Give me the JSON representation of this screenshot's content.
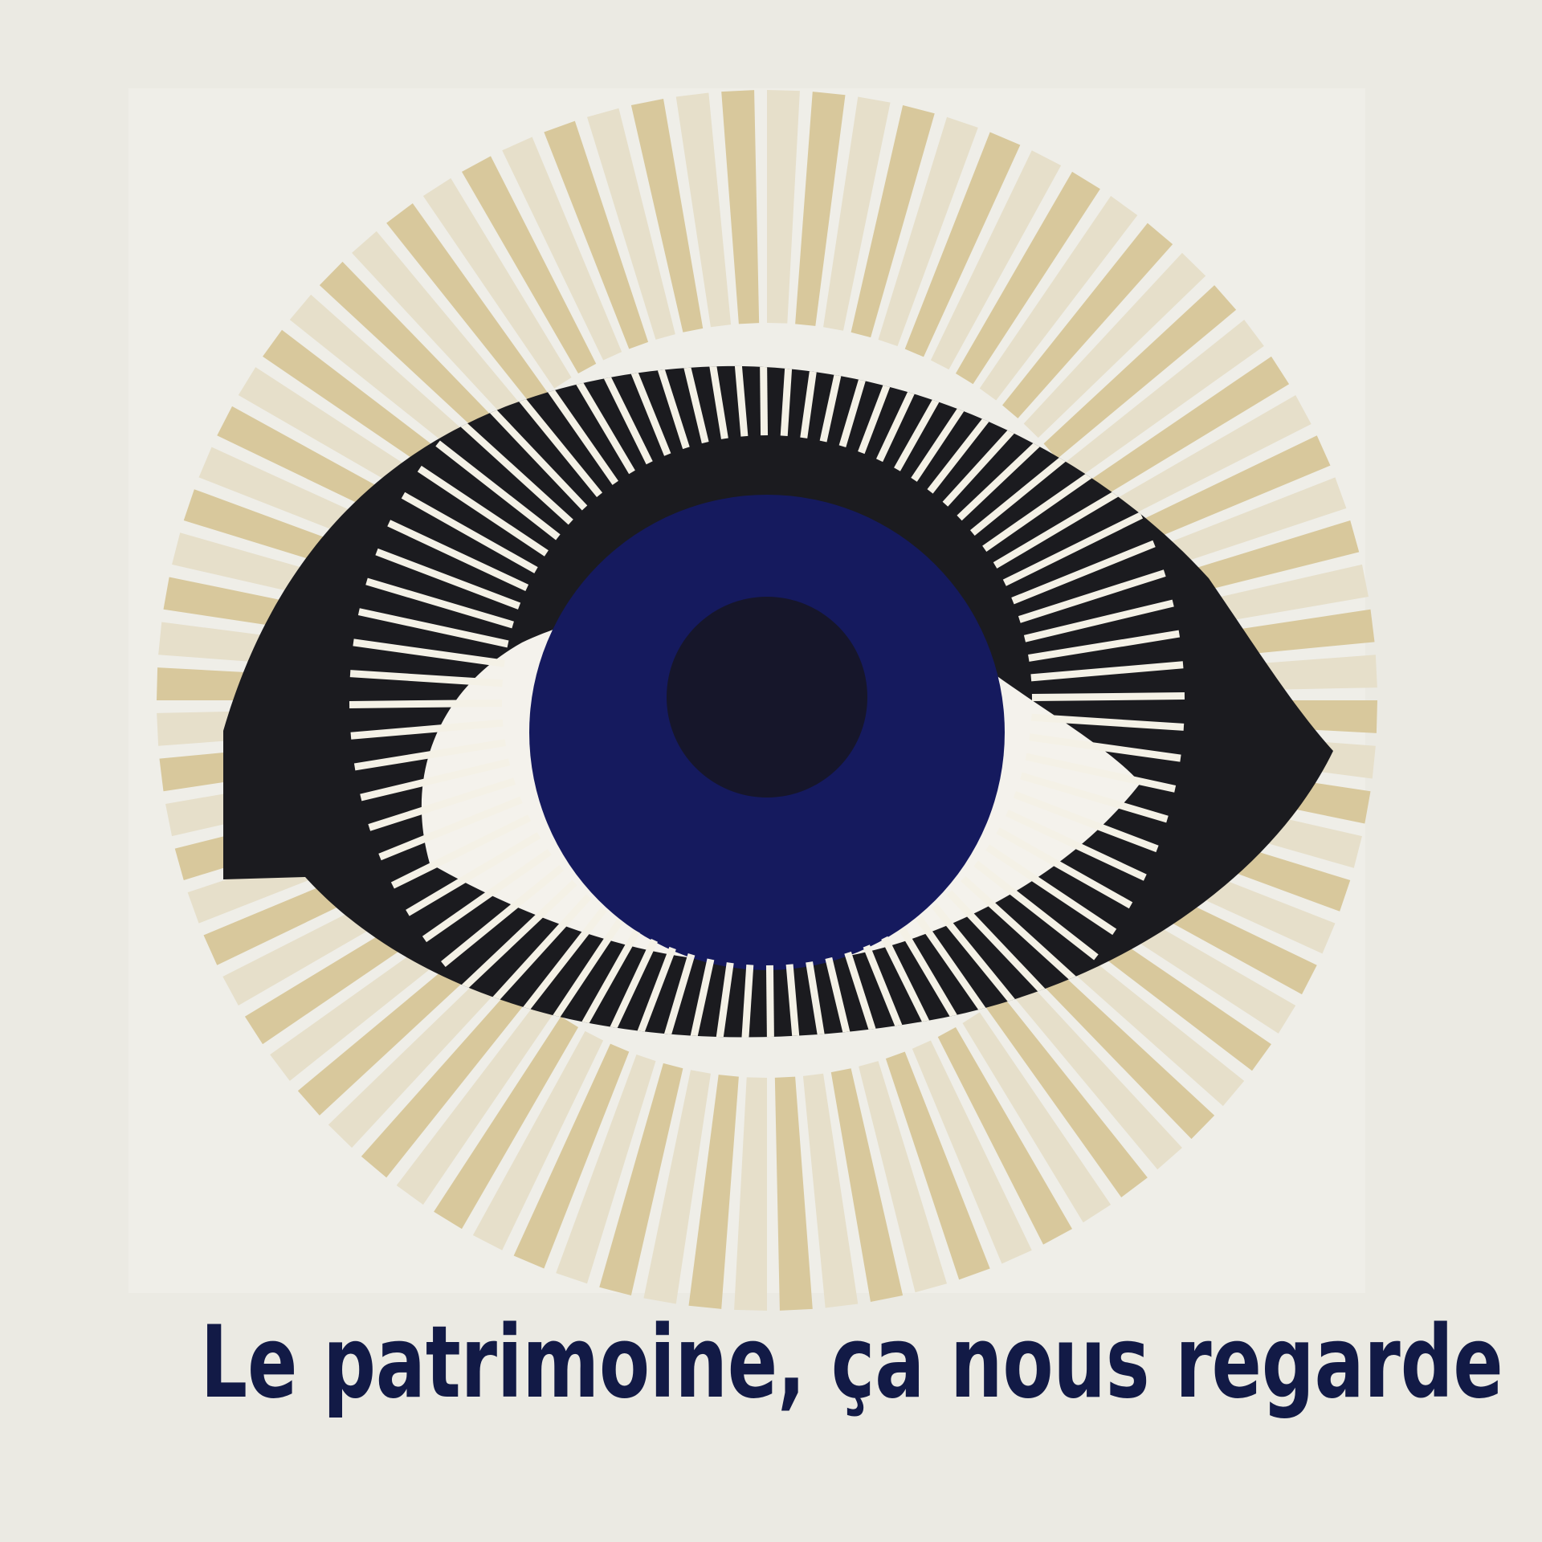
{
  "poster": {
    "caption": "Le patrimoine, ça nous regarde"
  },
  "colors": {
    "background": "#ebeae3",
    "panel": "#efeee8",
    "ray_gold": "#d8c89c",
    "ray_pale": "#e6dfca",
    "ray_gap": "#f4f1e6",
    "eye_black": "#1b1b1f",
    "eye_white": "#f4f2ec",
    "iris": "#151a5e",
    "pupil": "#16162a",
    "caption": "#121a46"
  },
  "icons": {
    "artwork": "eye-with-sunburst-icon"
  }
}
